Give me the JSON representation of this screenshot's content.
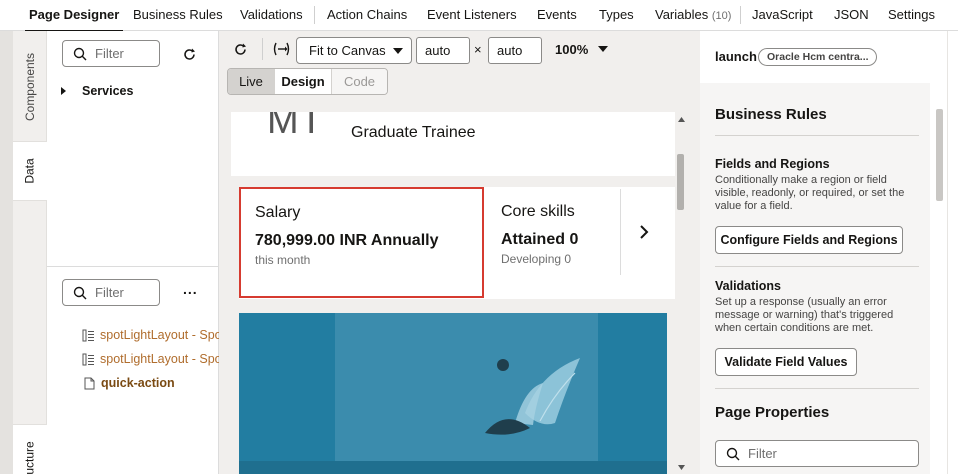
{
  "top_tabs": [
    {
      "label": "Page Designer",
      "active": true
    },
    {
      "label": "Business Rules"
    },
    {
      "label": "Validations"
    },
    {
      "label": "Action Chains"
    },
    {
      "label": "Event Listeners"
    },
    {
      "label": "Events"
    },
    {
      "label": "Types"
    },
    {
      "label": "Variables",
      "count": "(10)"
    },
    {
      "label": "JavaScript"
    },
    {
      "label": "JSON"
    },
    {
      "label": "Settings"
    }
  ],
  "left_strip": {
    "components": "Components",
    "data": "Data",
    "structure": "ucture"
  },
  "data_panel": {
    "filter_placeholder": "Filter",
    "services_label": "Services"
  },
  "structure_panel": {
    "filter_placeholder": "Filter",
    "more_label": "...",
    "items": [
      {
        "label": "spotLightLayout - Spo",
        "icon": "layout-icon"
      },
      {
        "label": "spotLightLayout - Spo",
        "icon": "layout-icon"
      },
      {
        "label": "quick-action",
        "icon": "file-icon"
      }
    ]
  },
  "canvas_toolbar": {
    "fit_label": "Fit to Canvas",
    "width_value": "auto",
    "times": "×",
    "height_value": "auto",
    "zoom": "100%",
    "modes": [
      "Live",
      "Design",
      "Code"
    ]
  },
  "preview": {
    "initials": "MT",
    "job_title": "Graduate Trainee",
    "salary_title": "Salary",
    "salary_value": "780,999.00 INR Annually",
    "salary_sub": "this month",
    "skills_title": "Core skills",
    "skills_value": "Attained 0",
    "skills_sub": "Developing 0"
  },
  "right_panel": {
    "launch_label": "launch",
    "chip_label": "Oracle Hcm centra...",
    "business_rules_title": "Business Rules",
    "fields_title": "Fields and Regions",
    "fields_desc": "Conditionally make a region or field visible, readonly, or required, or set the value for a field.",
    "fields_button": "Configure Fields and Regions",
    "validations_title": "Validations",
    "validations_desc": "Set up a response (usually an error message or warning) that's triggered when certain conditions are met.",
    "validations_button": "Validate Field Values",
    "page_props_title": "Page Properties",
    "filter_placeholder": "Filter"
  },
  "colors": {
    "accent": "#161513",
    "highlight_border": "#d63b30",
    "banner": "#227da1",
    "layout_link": "#b06d2d"
  }
}
